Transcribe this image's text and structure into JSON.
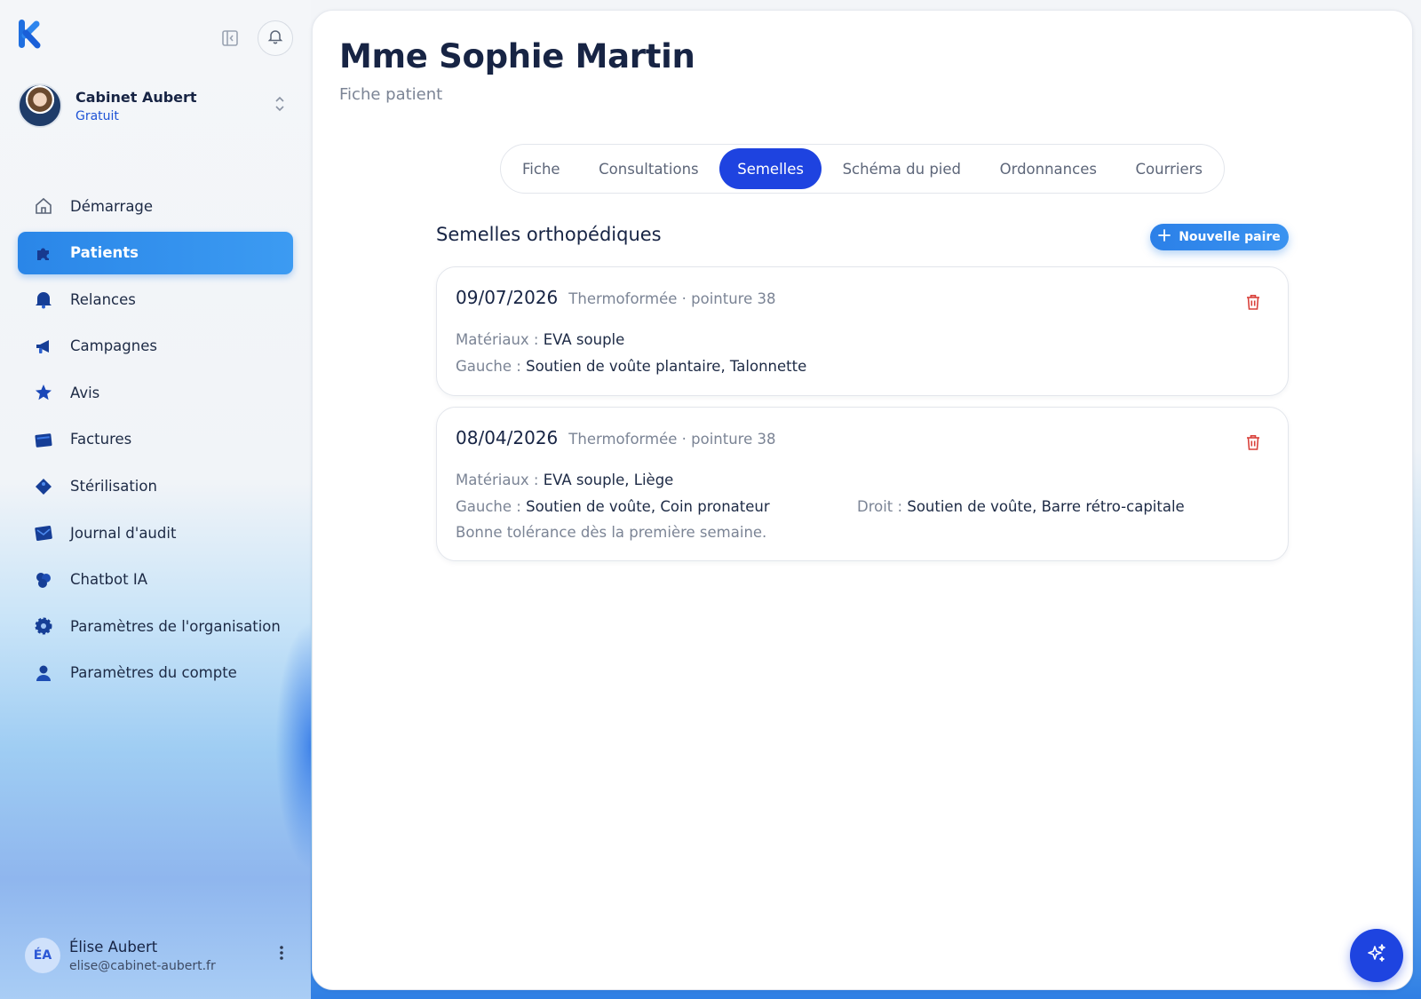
{
  "sidebar": {
    "organization": {
      "name": "Cabinet Aubert",
      "plan": "Gratuit"
    },
    "nav_items": [
      {
        "label": "Démarrage",
        "icon": "home-icon"
      },
      {
        "label": "Patients",
        "icon": "puzzle-icon",
        "active": true
      },
      {
        "label": "Relances",
        "icon": "bell-icon"
      },
      {
        "label": "Campagnes",
        "icon": "megaphone-icon"
      },
      {
        "label": "Avis",
        "icon": "star-icon"
      },
      {
        "label": "Factures",
        "icon": "invoice-icon"
      },
      {
        "label": "Stérilisation",
        "icon": "tag-icon"
      },
      {
        "label": "Journal d'audit",
        "icon": "mail-icon"
      },
      {
        "label": "Chatbot IA",
        "icon": "chatbot-icon"
      },
      {
        "label": "Paramètres de l'organisation",
        "icon": "gear-icon"
      },
      {
        "label": "Paramètres du compte",
        "icon": "user-icon"
      }
    ],
    "user": {
      "initials": "ÉA",
      "name": "Élise Aubert",
      "email": "elise@cabinet-aubert.fr"
    }
  },
  "main": {
    "title": "Mme Sophie Martin",
    "subtitle": "Fiche patient",
    "tabs": [
      {
        "label": "Fiche"
      },
      {
        "label": "Consultations"
      },
      {
        "label": "Semelles",
        "active": true
      },
      {
        "label": "Schéma du pied"
      },
      {
        "label": "Ordonnances"
      },
      {
        "label": "Courriers"
      }
    ],
    "section_title": "Semelles orthopédiques",
    "new_button_label": "Nouvelle paire",
    "cards": [
      {
        "date": "09/07/2026",
        "meta": "Thermoformée · pointure 38",
        "materials_label": "Matériaux :",
        "materials": "EVA souple",
        "left_label": "Gauche :",
        "left": "Soutien de voûte plantaire, Talonnette"
      },
      {
        "date": "08/04/2026",
        "meta": "Thermoformée · pointure 38",
        "materials_label": "Matériaux :",
        "materials": "EVA souple, Liège",
        "left_label": "Gauche :",
        "left": "Soutien de voûte, Coin pronateur",
        "right_label": "Droit :",
        "right": "Soutien de voûte, Barre rétro-capitale",
        "note": "Bonne tolérance dès la première semaine."
      }
    ]
  },
  "colors": {
    "primary": "#1e43e0",
    "accent": "#2a86e8",
    "danger": "#d9403a",
    "text": "#172444",
    "muted": "#7b8495"
  }
}
